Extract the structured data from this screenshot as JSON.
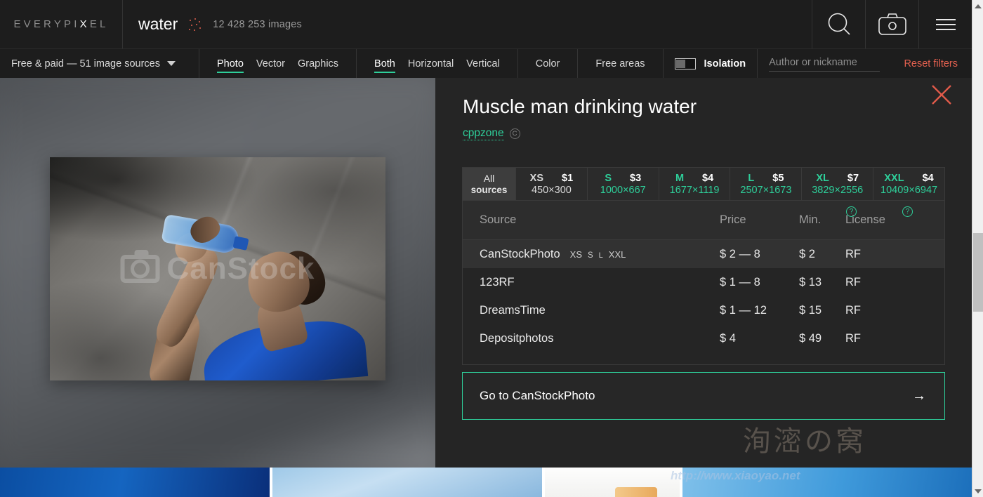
{
  "header": {
    "logo": "EVERYPIXEL",
    "logo_highlight_char": "X",
    "query": "water",
    "dots_icon": "dots-pattern-icon",
    "images_count": "12 428 253 images",
    "search_icon": "search-icon",
    "camera_icon": "camera-icon",
    "menu_icon": "hamburger-menu-icon"
  },
  "filters": {
    "sources_label": "Free & paid — 51 image sources",
    "sources_caret": "chevron-down-icon",
    "media_types": [
      {
        "label": "Photo",
        "active": true
      },
      {
        "label": "Vector",
        "active": false
      },
      {
        "label": "Graphics",
        "active": false
      }
    ],
    "orientations": [
      {
        "label": "Both",
        "active": true
      },
      {
        "label": "Horizontal",
        "active": false
      },
      {
        "label": "Vertical",
        "active": false
      }
    ],
    "color_label": "Color",
    "free_areas_label": "Free areas",
    "isolation_label": "Isolation",
    "isolation_state": "off",
    "author_placeholder": "Author or nickname",
    "author_value": "",
    "reset_label": "Reset filters"
  },
  "detail": {
    "title": "Muscle man drinking water",
    "author": "cppzone",
    "copyright_icon": "copyright-icon",
    "close_icon": "close-icon",
    "watermark": "CanStock",
    "watermark_icon": "camera-watermark-icon",
    "size_tabs": [
      {
        "label": "All",
        "label2": "sources",
        "price": "",
        "dims": "",
        "active": true,
        "style": "all"
      },
      {
        "label": "XS",
        "price": "$1",
        "dims": "450×300",
        "active": false,
        "style": "grey"
      },
      {
        "label": "S",
        "price": "$3",
        "dims": "1000×667",
        "active": false,
        "style": "green"
      },
      {
        "label": "M",
        "price": "$4",
        "dims": "1677×1119",
        "active": false,
        "style": "green"
      },
      {
        "label": "L",
        "price": "$5",
        "dims": "2507×1673",
        "active": false,
        "style": "green"
      },
      {
        "label": "XL",
        "price": "$7",
        "dims": "3829×2556",
        "active": false,
        "style": "green"
      },
      {
        "label": "XXL",
        "price": "$4",
        "dims": "10409×6947",
        "active": false,
        "style": "green"
      }
    ],
    "table": {
      "columns": [
        "Source",
        "Price",
        "Min.",
        "License"
      ],
      "help_icon": "question-mark-icon",
      "rows": [
        {
          "source": "CanStockPhoto",
          "sizes": [
            "XS",
            "S",
            "L",
            "XXL"
          ],
          "price": "$ 2 — 8",
          "min": "$ 2",
          "license": "RF",
          "selected": true
        },
        {
          "source": "123RF",
          "sizes": [],
          "price": "$ 1 — 8",
          "min": "$ 13",
          "license": "RF",
          "selected": false
        },
        {
          "source": "DreamsTime",
          "sizes": [],
          "price": "$ 1 — 12",
          "min": "$ 15",
          "license": "RF",
          "selected": false
        },
        {
          "source": "Depositphotos",
          "sizes": [],
          "price": "$ 4",
          "min": "$ 49",
          "license": "RF",
          "selected": false
        }
      ]
    },
    "cta_label": "Go to CanStockPhoto",
    "cta_arrow": "arrow-right-icon"
  },
  "overlay": {
    "cn_watermark": "洵滵の窝",
    "url_watermark": "http://www.xiaoyao.net"
  },
  "colors": {
    "accent_green": "#2ecf9a",
    "accent_red": "#e2604f",
    "panel_bg": "#252525",
    "topbar_bg": "#1d1d1d"
  },
  "scrollbar": {
    "up_icon": "scroll-up-arrow-icon",
    "down_icon": "scroll-down-arrow-icon"
  }
}
